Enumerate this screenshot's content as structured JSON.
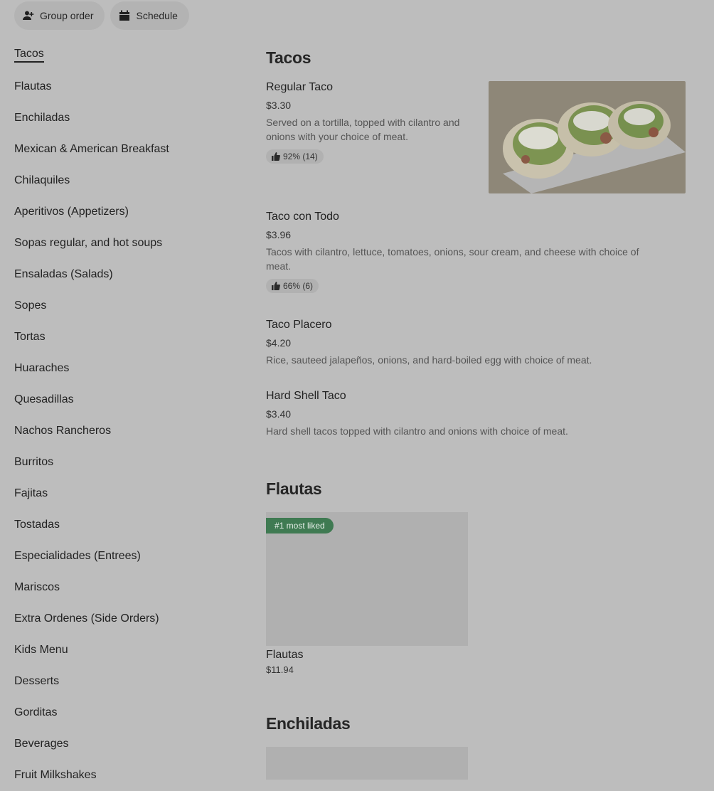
{
  "toolbar": {
    "group_order_label": "Group order",
    "schedule_label": "Schedule",
    "group_order_icon": "person-add-icon",
    "schedule_icon": "calendar-icon"
  },
  "sidebar": {
    "items": [
      "Tacos",
      "Flautas",
      "Enchiladas",
      "Mexican & American Breakfast",
      "Chilaquiles",
      "Aperitivos (Appetizers)",
      "Sopas regular, and hot soups",
      "Ensaladas (Salads)",
      "Sopes",
      "Tortas",
      "Huaraches",
      "Quesadillas",
      "Nachos Rancheros",
      "Burritos",
      "Fajitas",
      "Tostadas",
      "Especialidades (Entrees)",
      "Mariscos",
      "Extra Ordenes (Side Orders)",
      "Kids Menu",
      "Desserts",
      "Gorditas",
      "Beverages",
      "Fruit Milkshakes"
    ],
    "active": "Tacos"
  },
  "sections": {
    "tacos": {
      "title": "Tacos",
      "items": [
        {
          "name": "Regular Taco",
          "price": "$3.30",
          "description": "Served on a tortilla, topped with cilantro and onions with your choice of meat.",
          "rating": "92% (14)"
        },
        {
          "name": "Taco con Todo",
          "price": "$3.96",
          "description": "Tacos with cilantro, lettuce, tomatoes, onions, sour cream, and cheese with choice of meat.",
          "rating": "66% (6)"
        },
        {
          "name": "Taco Placero",
          "price": "$4.20",
          "description": "Rice, sauteed jalapeños, onions, and hard-boiled egg with choice of meat."
        },
        {
          "name": "Hard Shell Taco",
          "price": "$3.40",
          "description": "Hard shell tacos topped with cilantro and onions with choice of meat."
        }
      ]
    },
    "flautas": {
      "title": "Flautas",
      "badge": "#1 most liked",
      "items": [
        {
          "name": "Flautas",
          "price": "$11.94"
        }
      ]
    },
    "enchiladas": {
      "title": "Enchiladas"
    }
  },
  "icons": {
    "thumbs_up": "thumbs-up-icon"
  },
  "colors": {
    "overlay_bg": "#bdbdbd",
    "badge_green": "#3f7a52"
  }
}
